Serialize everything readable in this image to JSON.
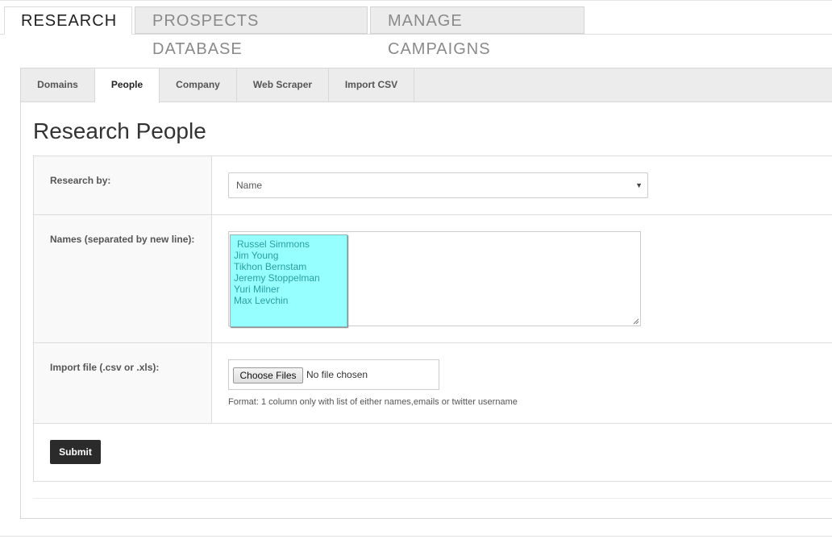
{
  "top_tabs": [
    {
      "label": "RESEARCH",
      "active": true
    },
    {
      "label": "PROSPECTS DATABASE",
      "active": false
    },
    {
      "label": "MANAGE CAMPAIGNS",
      "active": false
    }
  ],
  "sub_tabs": [
    {
      "label": "Domains",
      "active": false
    },
    {
      "label": "People",
      "active": true
    },
    {
      "label": "Company",
      "active": false
    },
    {
      "label": "Web Scraper",
      "active": false
    },
    {
      "label": "Import CSV",
      "active": false
    }
  ],
  "page_title": "Research People",
  "form": {
    "research_by": {
      "label": "Research by:",
      "selected": "Name",
      "caret_icon": "triangle-down"
    },
    "names": {
      "label": "Names (separated by new line):",
      "values": [
        "Russel Simmons",
        "Jim Young",
        "Tikhon Bernstam",
        "Jeremy Stoppelman",
        "Yuri Milner",
        "Max Levchin"
      ],
      "highlight_color": "#96ffff"
    },
    "import_file": {
      "label": "Import file (.csv or .xls):",
      "button_label": "Choose Files",
      "status": "No file chosen",
      "help": "Format: 1 column only with list of either names,emails or twitter username"
    },
    "submit_label": "Submit"
  }
}
